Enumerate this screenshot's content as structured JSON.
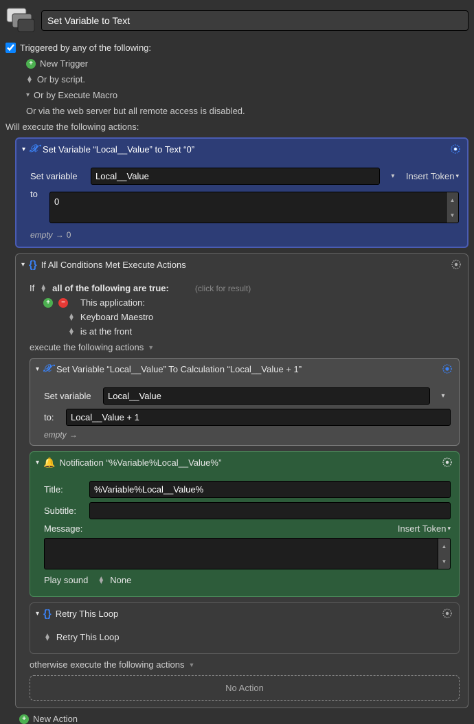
{
  "header": {
    "title": "Set Variable to Text"
  },
  "triggers": {
    "checkbox_label": "Triggered by any of the following:",
    "new_trigger_label": "New Trigger",
    "or_by_script": "Or by script.",
    "or_by_execute_macro": "Or by Execute Macro",
    "web_server_note": "Or via the web server but all remote access is disabled."
  },
  "actions_label": "Will execute the following actions:",
  "action1": {
    "title": "Set Variable “Local__Value” to Text “0”",
    "set_variable_label": "Set variable",
    "variable_name": "Local__Value",
    "to_label": "to",
    "to_value": "0",
    "insert_token": "Insert Token",
    "result_prefix": "empty",
    "result_value": "0"
  },
  "action2": {
    "title": "If All Conditions Met Execute Actions",
    "if_label": "If",
    "all_of_following": "all of the following are true:",
    "click_for_result": "(click for result)",
    "this_application": "This application:",
    "app_name": "Keyboard Maestro",
    "is_at_front": "is at the front",
    "execute_label": "execute the following actions",
    "otherwise_label": "otherwise execute the following actions",
    "no_action": "No Action",
    "nested1": {
      "title": "Set Variable “Local__Value” To Calculation “Local__Value + 1”",
      "set_variable_label": "Set variable",
      "variable_name": "Local__Value",
      "to_label": "to:",
      "to_value": "Local__Value + 1",
      "result_prefix": "empty"
    },
    "nested2": {
      "title": "Notification “%Variable%Local__Value%”",
      "title_label": "Title:",
      "title_value": "%Variable%Local__Value%",
      "subtitle_label": "Subtitle:",
      "subtitle_value": "",
      "message_label": "Message:",
      "insert_token": "Insert Token",
      "play_sound_label": "Play sound",
      "play_sound_value": "None"
    },
    "nested3": {
      "title": "Retry This Loop",
      "body": "Retry This Loop"
    }
  },
  "footer": {
    "new_action": "New Action"
  }
}
